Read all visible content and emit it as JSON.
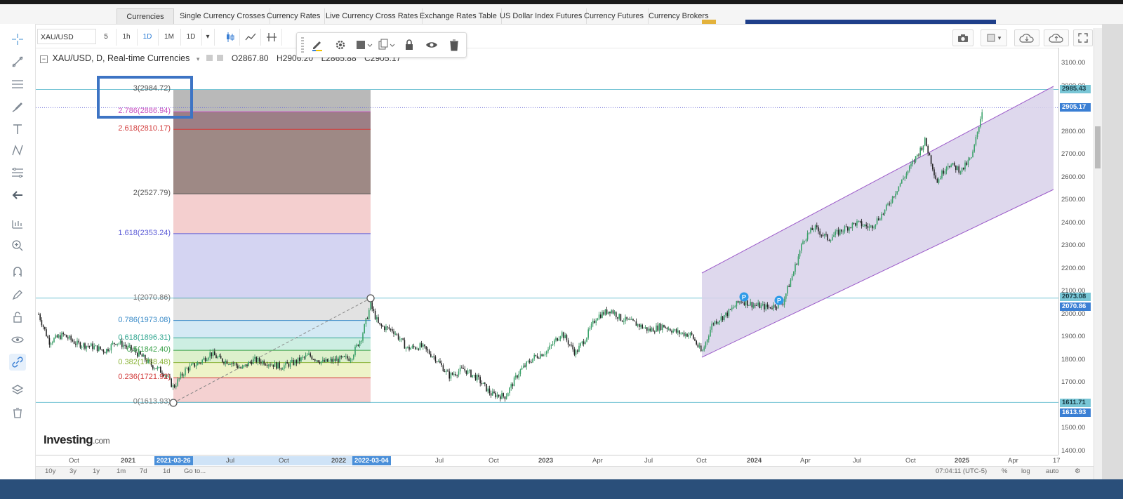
{
  "nav": {
    "items": [
      "Currencies",
      "Single Currency Crosses",
      "Currency Rates",
      "Live Currency Cross Rates",
      "Exchange Rates Table",
      "US Dollar Index Futures",
      "Currency Futures",
      "Currency Brokers"
    ]
  },
  "toolbar": {
    "symbol": "XAU/USD",
    "intervals": [
      "5",
      "1h",
      "1D",
      "1M",
      "1D"
    ],
    "active_interval_index": 2
  },
  "legend": {
    "title": "XAU/USD, D, Real-time Currencies",
    "open": "O2867.80",
    "high": "H2906.20",
    "low": "L2865.88",
    "close": "C2905.17"
  },
  "fib_levels": [
    {
      "label": "3(2984.72)",
      "color": "#555555"
    },
    {
      "label": "2.786(2886.94)",
      "color": "#c94fc0"
    },
    {
      "label": "2.618(2810.17)",
      "color": "#d23b3b"
    },
    {
      "label": "2(2527.79)",
      "color": "#555555"
    },
    {
      "label": "1.618(2353.24)",
      "color": "#5a5ad6"
    },
    {
      "label": "1(2070.86)",
      "color": "#777777"
    },
    {
      "label": "0.786(1973.08)",
      "color": "#3a8bc8"
    },
    {
      "label": "0.618(1896.31)",
      "color": "#2ea58f"
    },
    {
      "label": "0.5(1842.40)",
      "color": "#3aa14a"
    },
    {
      "label": "0.382(1788.48)",
      "color": "#8bb43a"
    },
    {
      "label": "0.236(1721.92)",
      "color": "#d23b3b"
    },
    {
      "label": "0(1613.93)",
      "color": "#777777"
    }
  ],
  "price_axis": {
    "labels": [
      "3100.00",
      "3000.00",
      "2900.00",
      "2800.00",
      "2700.00",
      "2600.00",
      "2500.00",
      "2400.00",
      "2300.00",
      "2200.00",
      "2100.00",
      "2000.00",
      "1900.00",
      "1800.00",
      "1700.00",
      "1600.00",
      "1500.00",
      "1400.00"
    ],
    "tags": [
      {
        "text": "2985.43",
        "bg": "#79c6d6",
        "fg": "#1a3a44"
      },
      {
        "text": "2905.17",
        "bg": "#3a7fd4",
        "fg": "#ffffff"
      },
      {
        "text": "2073.08",
        "bg": "#79c6d6",
        "fg": "#1a3a44"
      },
      {
        "text": "2070.86",
        "bg": "#3a7fd4",
        "fg": "#ffffff"
      },
      {
        "text": "1611.71",
        "bg": "#79c6d6",
        "fg": "#1a3a44"
      },
      {
        "text": "1613.93",
        "bg": "#3a7fd4",
        "fg": "#ffffff"
      }
    ]
  },
  "time_axis": {
    "labels": [
      "Oct",
      "2021",
      "Jul",
      "Oct",
      "2022",
      "Jul",
      "Oct",
      "2023",
      "Apr",
      "Jul",
      "Oct",
      "2024",
      "Apr",
      "Jul",
      "Oct",
      "2025",
      "Apr",
      "17"
    ],
    "tags": [
      "2021-03-26",
      "2022-03-04"
    ]
  },
  "bottom_bar": {
    "ranges": [
      "10y",
      "3y",
      "1y",
      "1m",
      "7d",
      "1d"
    ],
    "goto": "Go to...",
    "clock": "07:04:11 (UTC-5)",
    "percent": "%",
    "log": "log",
    "auto": "auto"
  },
  "markers": [
    "P",
    "P"
  ],
  "logo": {
    "brand": "Investing",
    "suffix": ".com"
  },
  "colors": {
    "channel_fill": "#d8d1ea",
    "channel_line": "#9b59c9",
    "hline": "#79c6d6",
    "candle_up": "#2e8b57",
    "candle_down": "#222222",
    "accent": "#3a7fd4"
  }
}
